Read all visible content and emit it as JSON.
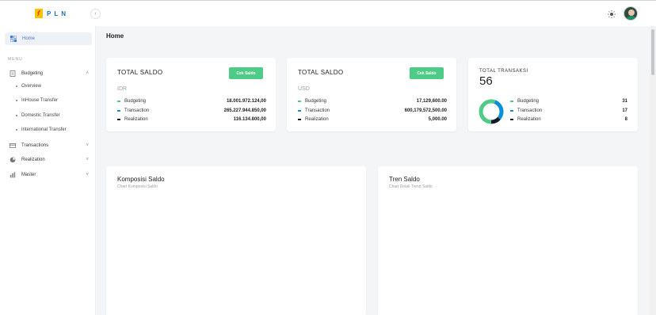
{
  "header": {
    "logo_text": "PLN",
    "collapse_icon": "chevron-left-icon",
    "theme_icon": "sun-icon",
    "avatar_icon": "user-avatar"
  },
  "sidebar": {
    "home_label": "Home",
    "menu_label": "MENU",
    "items": [
      {
        "label": "Budgeting",
        "icon": "document-icon",
        "chevron": "˄"
      },
      {
        "label": "Transactions",
        "icon": "card-icon",
        "chevron": "˅"
      },
      {
        "label": "Realization",
        "icon": "pie-icon",
        "chevron": "˅"
      },
      {
        "label": "Master",
        "icon": "chart-icon",
        "chevron": "˅"
      }
    ],
    "budgeting_sub": [
      "Overview",
      "InHouse Transfer",
      "Domestic Transfer",
      "International Transfer"
    ]
  },
  "page": {
    "title": "Home"
  },
  "cards": {
    "idr": {
      "title": "TOTAL SALDO",
      "button": "Cek Saldo",
      "currency": "IDR",
      "rows": [
        {
          "label": "Budgeting",
          "value": "18.001.972.124,00"
        },
        {
          "label": "Transaction",
          "value": "265.227.944.850,00"
        },
        {
          "label": "Realization",
          "value": "116.134.800,00"
        }
      ]
    },
    "usd": {
      "title": "TOTAL SALDO",
      "button": "Cek Saldo",
      "currency": "USD",
      "rows": [
        {
          "label": "Budgeting",
          "value": "17,129,600.00"
        },
        {
          "label": "Transaction",
          "value": "600,179,572,500.00"
        },
        {
          "label": "Realization",
          "value": "5,000.00"
        }
      ]
    },
    "transaksi": {
      "title": "TOTAL TRANSAKSI",
      "total": "56",
      "rows": [
        {
          "label": "Budgeting",
          "value": "31"
        },
        {
          "label": "Transaction",
          "value": "17"
        },
        {
          "label": "Realization",
          "value": "8"
        }
      ]
    }
  },
  "donut": {
    "values": [
      31,
      17,
      8
    ],
    "colors": [
      "#4ecb86",
      "#0b8fd8",
      "#111a2a"
    ]
  },
  "row_colors": {
    "budgeting": "#4ecb86",
    "transaction": "#0b8fd8",
    "realization": "#111a2a"
  },
  "komposisi": {
    "title": "Komposisi Saldo",
    "subtitle": "Chart Komposisi Saldo"
  },
  "tren": {
    "title": "Tren Saldo",
    "subtitle": "Chart Detail Trend Saldo"
  }
}
